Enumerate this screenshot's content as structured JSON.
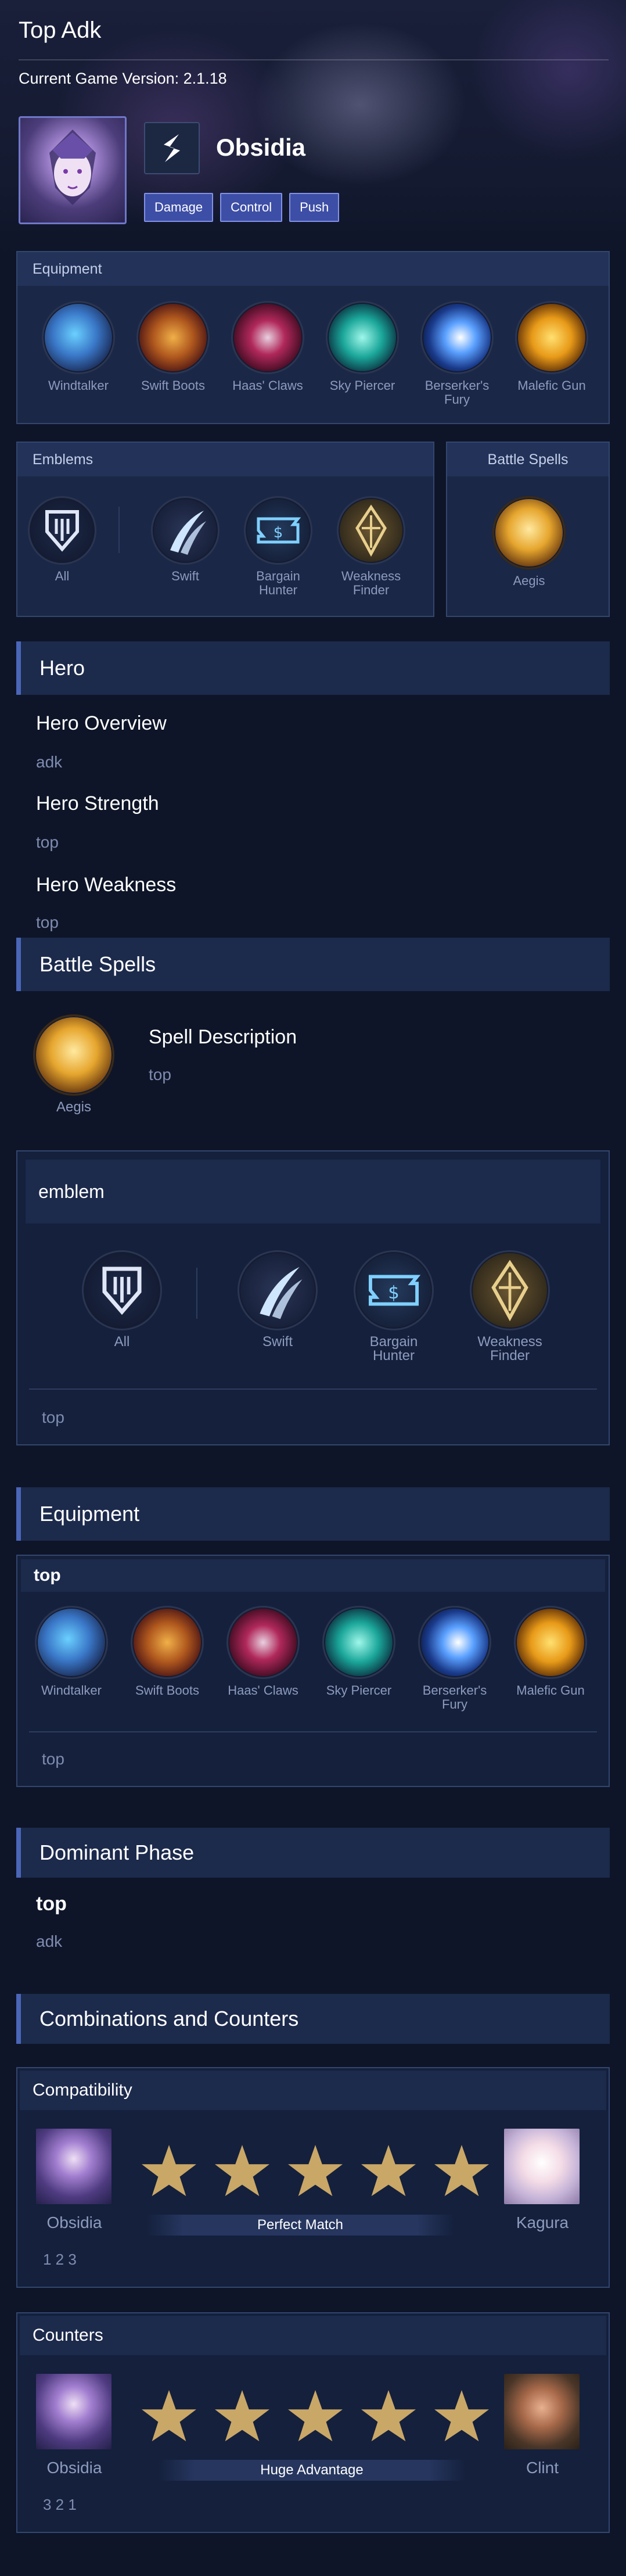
{
  "page_title": "Top Adk",
  "version_text": "Current Game Version: 2.1.18",
  "hero": {
    "name": "Obsidia",
    "tags": [
      "Damage",
      "Control",
      "Push"
    ]
  },
  "equipment": {
    "title": "Equipment",
    "items": [
      {
        "name": "Windtalker",
        "icon": "windtalker-icon"
      },
      {
        "name": "Swift Boots",
        "icon": "swift-boots-icon"
      },
      {
        "name": "Haas' Claws",
        "icon": "haas-claws-icon"
      },
      {
        "name": "Sky Piercer",
        "icon": "sky-piercer-icon"
      },
      {
        "name": "Berserker's Fury",
        "icon": "berserkers-fury-icon"
      },
      {
        "name": "Malefic Gun",
        "icon": "malefic-gun-icon"
      }
    ]
  },
  "emblems": {
    "title": "Emblems",
    "main": "All",
    "talents": [
      "Swift",
      "Bargain Hunter",
      "Weakness Finder"
    ]
  },
  "battle_spells_card": {
    "title": "Battle Spells",
    "spell": "Aegis"
  },
  "hero_section": {
    "title": "Hero",
    "overview_title": "Hero Overview",
    "overview_text": "adk",
    "strength_title": "Hero Strength",
    "strength_text": "top",
    "weakness_title": "Hero Weakness",
    "weakness_text": "top"
  },
  "battle_spells_section": {
    "title": "Battle Spells",
    "spell": "Aegis",
    "desc_title": "Spell Description",
    "desc_text": "top"
  },
  "emblem_section": {
    "title": "emblem",
    "main": "All",
    "talents": [
      "Swift",
      "Bargain Hunter",
      "Weakness Finder"
    ],
    "note": "top"
  },
  "equipment_section": {
    "title": "Equipment",
    "build_title": "top",
    "items": [
      "Windtalker",
      "Swift Boots",
      "Haas' Claws",
      "Sky Piercer",
      "Berserker's Fury",
      "Malefic Gun"
    ],
    "note": "top"
  },
  "dominant_phase": {
    "title": "Dominant Phase",
    "phase": "top",
    "text": "adk"
  },
  "combos": {
    "title": "Combinations and Counters",
    "compatibility": {
      "title": "Compatibility",
      "left_hero": "Obsidia",
      "right_hero": "Kagura",
      "stars": 5,
      "label": "Perfect Match",
      "footer": "1 2 3"
    },
    "counters": {
      "title": "Counters",
      "left_hero": "Obsidia",
      "right_hero": "Clint",
      "stars": 5,
      "label": "Huge Advantage",
      "footer": "3 2 1"
    }
  },
  "colors": {
    "background": "#0e1528",
    "panel": "#1a2746",
    "accent": "#4a66b8",
    "tag": "#3d4ea6",
    "star": "#c9a767"
  }
}
